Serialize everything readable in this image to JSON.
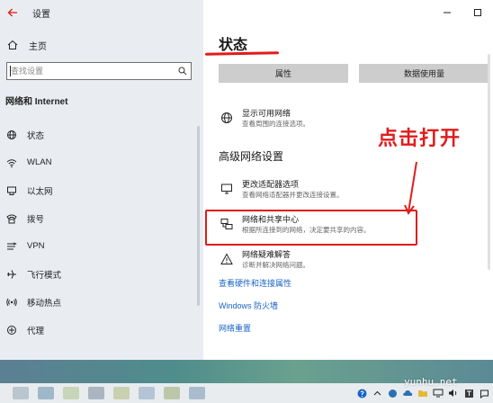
{
  "window": {
    "title": "设置"
  },
  "sidebar": {
    "home_label": "主页",
    "search_placeholder": "查找设置",
    "section_title": "网络和 Internet",
    "items": [
      {
        "label": "状态",
        "icon": "globe-icon"
      },
      {
        "label": "WLAN",
        "icon": "wifi-icon"
      },
      {
        "label": "以太网",
        "icon": "ethernet-icon"
      },
      {
        "label": "拨号",
        "icon": "dialup-icon"
      },
      {
        "label": "VPN",
        "icon": "vpn-icon"
      },
      {
        "label": "飞行模式",
        "icon": "airplane-icon"
      },
      {
        "label": "移动热点",
        "icon": "hotspot-icon"
      },
      {
        "label": "代理",
        "icon": "proxy-icon"
      }
    ]
  },
  "main": {
    "page_title": "状态",
    "buttons": {
      "properties": "属性",
      "data_usage": "数据使用量"
    },
    "show_networks": {
      "title": "显示可用网络",
      "desc": "查看周围的连接选项。"
    },
    "advanced_heading": "高级网络设置",
    "adapter_options": {
      "title": "更改适配器选项",
      "desc": "查看网络适配器并更改连接设置。"
    },
    "sharing_center": {
      "title": "网络和共享中心",
      "desc": "根据所连接到的网络，决定要共享的内容。"
    },
    "troubleshooter": {
      "title": "网络疑难解答",
      "desc": "诊断并解决网络问题。"
    },
    "links": {
      "hardware": "查看硬件和连接属性",
      "firewall": "Windows 防火墙",
      "reset": "网络重置"
    },
    "annotation": "点击打开"
  },
  "watermark": "yunhu.net",
  "colors": {
    "accent_red": "#e21b1b",
    "link_blue": "#1a64c8",
    "sidebar_bg": "#e9edf2",
    "button_gray": "#cdcdcd"
  }
}
